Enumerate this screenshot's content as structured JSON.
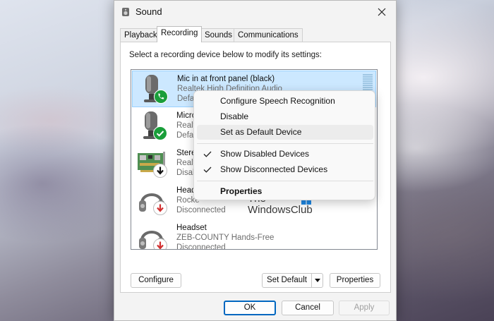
{
  "window": {
    "title": "Sound",
    "close_icon": "close-icon",
    "app_icon": "speaker-icon"
  },
  "tabs": [
    {
      "label": "Playback",
      "active": false
    },
    {
      "label": "Recording",
      "active": true
    },
    {
      "label": "Sounds",
      "active": false
    },
    {
      "label": "Communications",
      "active": false
    }
  ],
  "recording": {
    "instruction": "Select a recording device below to modify its settings:",
    "devices": [
      {
        "name": "Mic in at front panel (black)",
        "sub": "Realtek High Definition Audio",
        "status": "Defau",
        "icon": "microphone-icon",
        "badge": "phone-green-badge",
        "selected": true
      },
      {
        "name": "Micro",
        "sub": "Realt",
        "status": "Defau",
        "icon": "microphone-icon",
        "badge": "check-green-badge",
        "selected": false
      },
      {
        "name": "Stere",
        "sub": "Realt",
        "status": "Disab",
        "icon": "sound-card-icon",
        "badge": "down-arrow-black-badge",
        "selected": false
      },
      {
        "name": "Head",
        "sub": "Rocke",
        "status": "Disconnected",
        "icon": "headset-icon",
        "badge": "down-arrow-red-badge",
        "selected": false
      },
      {
        "name": "Headset",
        "sub": "ZEB-COUNTY Hands-Free",
        "status": "Disconnected",
        "icon": "headset-icon",
        "badge": "down-arrow-red-badge",
        "selected": false
      }
    ],
    "watermark": {
      "line1": "The",
      "line2": "WindowsClub"
    },
    "buttons": {
      "configure": "Configure",
      "set_default": "Set Default",
      "properties": "Properties"
    }
  },
  "context_menu": {
    "items": [
      {
        "label": "Configure Speech Recognition",
        "checked": false
      },
      {
        "label": "Disable",
        "checked": false
      },
      {
        "label": "Set as Default Device",
        "checked": false,
        "hover": true
      },
      {
        "label": "Show Disabled Devices",
        "checked": true
      },
      {
        "label": "Show Disconnected Devices",
        "checked": true
      },
      {
        "label": "Properties",
        "checked": false,
        "bold": true
      }
    ]
  },
  "footer": {
    "ok": "OK",
    "cancel": "Cancel",
    "apply": "Apply"
  },
  "colors": {
    "selection": "#cce8ff",
    "accent": "#0067c0",
    "badge_green": "#1a9e3a",
    "badge_red": "#d12f2f"
  }
}
